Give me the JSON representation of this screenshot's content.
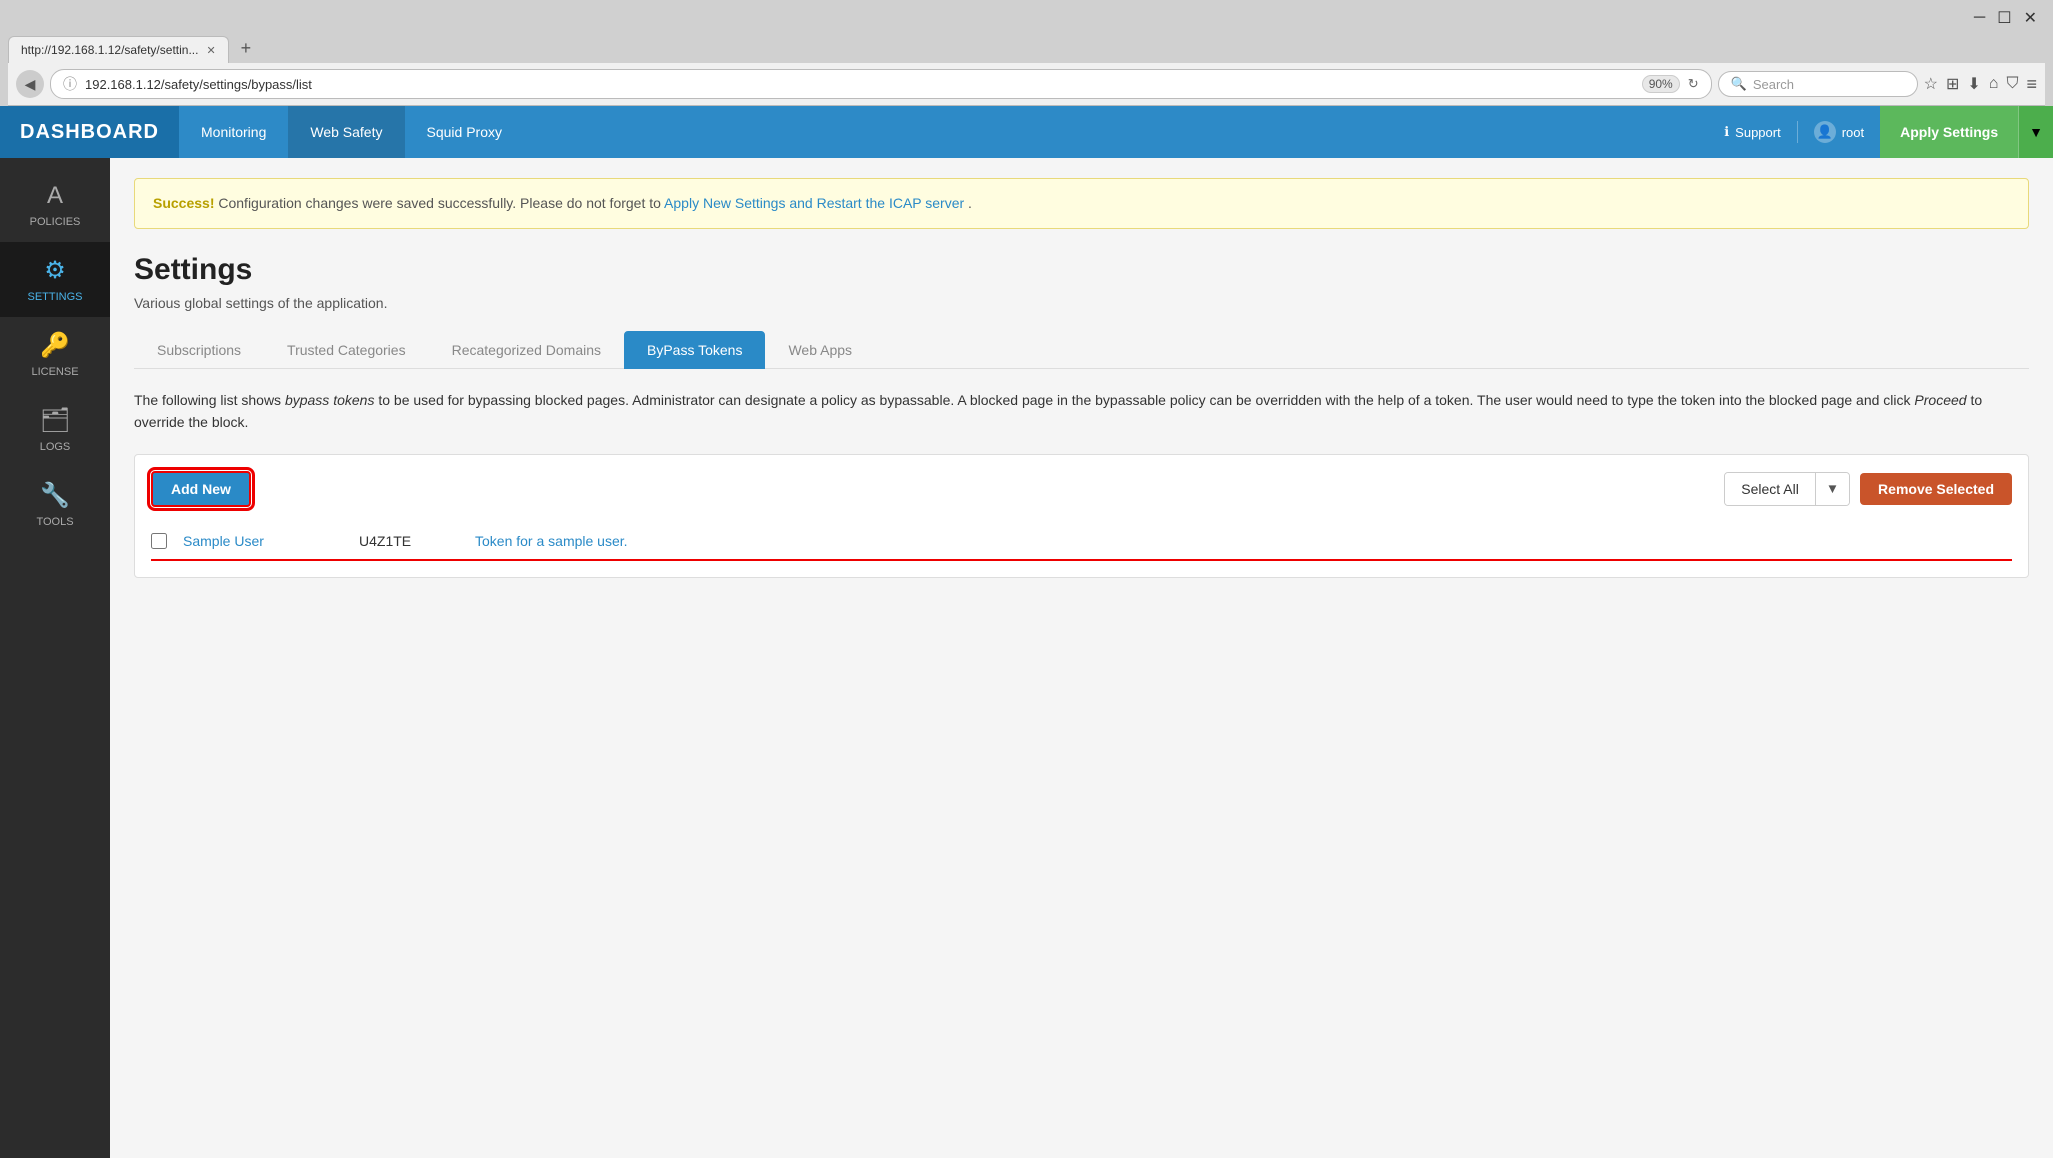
{
  "browser": {
    "tab_url": "http://192.168.1.12/safety/settin...",
    "tab_close": "✕",
    "tab_new": "+",
    "address_url": "192.168.1.12/safety/settings/bypass/list",
    "zoom": "90%",
    "search_placeholder": "Search",
    "back_btn": "◀",
    "info_icon": "ⓘ",
    "reload_icon": "↻",
    "bookmark_icon": "☆",
    "clipboard_icon": "⊞",
    "download_icon": "⬇",
    "home_icon": "⌂",
    "shield_icon": "⛉",
    "menu_icon": "≡",
    "minimize": "─",
    "maximize": "☐",
    "close_win": "✕"
  },
  "topnav": {
    "brand": "DASHBOARD",
    "items": [
      {
        "label": "Monitoring",
        "active": false
      },
      {
        "label": "Web Safety",
        "active": true
      },
      {
        "label": "Squid Proxy",
        "active": false
      }
    ],
    "support_label": "Support",
    "user_label": "root",
    "apply_label": "Apply Settings",
    "apply_arrow": "▼"
  },
  "sidebar": {
    "items": [
      {
        "label": "POLICIES",
        "icon": "A",
        "active": false
      },
      {
        "label": "SETTINGS",
        "icon": "⚙",
        "active": true
      },
      {
        "label": "LICENSE",
        "icon": "🔑",
        "active": false
      },
      {
        "label": "LOGS",
        "icon": "🗂",
        "active": false
      },
      {
        "label": "TOOLS",
        "icon": "🔧",
        "active": false
      }
    ]
  },
  "alert": {
    "bold": "Success!",
    "text1": " Configuration changes were saved successfully. Please do not forget to ",
    "link": "Apply New Settings and Restart the ICAP server",
    "text2": "."
  },
  "page": {
    "title": "Settings",
    "desc": "Various global settings of the application."
  },
  "tabs": [
    {
      "label": "Subscriptions",
      "active": false
    },
    {
      "label": "Trusted Categories",
      "active": false
    },
    {
      "label": "Recategorized Domains",
      "active": false
    },
    {
      "label": "ByPass Tokens",
      "active": true
    },
    {
      "label": "Web Apps",
      "active": false
    }
  ],
  "bypass_desc": "The following list shows bypass tokens to be used for bypassing blocked pages. Administrator can designate a policy as bypassable. A blocked page in the bypassable policy can be overridden with the help of a token. The user would need to type the token into the blocked page and click Proceed to override the block.",
  "tokens": {
    "add_new_label": "Add New",
    "select_all_label": "Select All",
    "select_all_arrow": "▼",
    "remove_selected_label": "Remove Selected",
    "rows": [
      {
        "checked": false,
        "name": "Sample User",
        "value": "U4Z1TE",
        "desc": "Token for a sample user."
      }
    ]
  }
}
